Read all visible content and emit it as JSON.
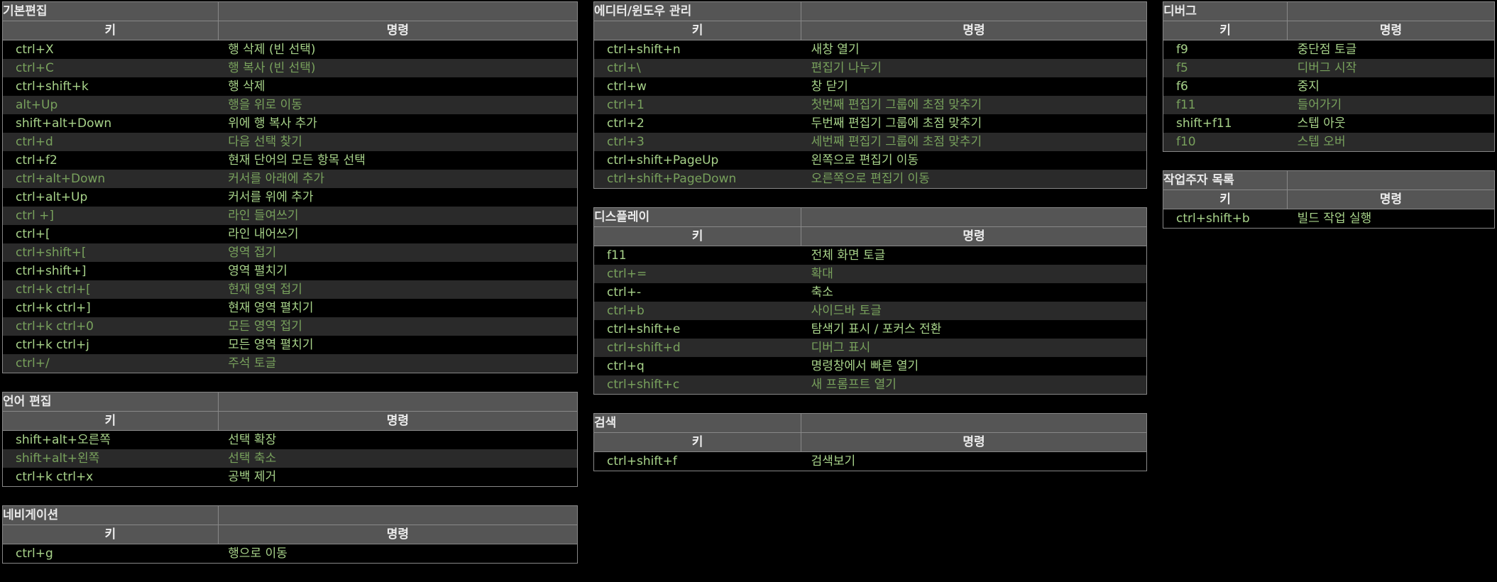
{
  "columns": [
    [
      {
        "title": "기본편집",
        "header_key": "키",
        "header_cmd": "명령",
        "rows": [
          {
            "key": "ctrl+X",
            "cmd": "행 삭제 (빈 선택)"
          },
          {
            "key": "ctrl+C",
            "cmd": "행 복사 (빈 선택)"
          },
          {
            "key": "ctrl+shift+k",
            "cmd": "행 삭제"
          },
          {
            "key": "alt+Up",
            "cmd": "행을 위로 이동"
          },
          {
            "key": "shift+alt+Down",
            "cmd": "위에 행 복사 추가"
          },
          {
            "key": "ctrl+d",
            "cmd": "다음 선택 찾기"
          },
          {
            "key": "ctrl+f2",
            "cmd": "현재 단어의 모든 항목 선택"
          },
          {
            "key": "ctrl+alt+Down",
            "cmd": "커서를 아래에 추가"
          },
          {
            "key": "ctrl+alt+Up",
            "cmd": "커서를 위에 추가"
          },
          {
            "key": "ctrl +]",
            "cmd": "라인 들여쓰기"
          },
          {
            "key": "ctrl+[",
            "cmd": "라인 내어쓰기"
          },
          {
            "key": "ctrl+shift+[",
            "cmd": "영역 접기"
          },
          {
            "key": "ctrl+shift+]",
            "cmd": "영역 펼치기"
          },
          {
            "key": "ctrl+k ctrl+[",
            "cmd": "현재 영역 접기"
          },
          {
            "key": "ctrl+k ctrl+]",
            "cmd": "현재 영역 펼치기"
          },
          {
            "key": "ctrl+k ctrl+0",
            "cmd": "모든 영역 접기"
          },
          {
            "key": "ctrl+k ctrl+j",
            "cmd": "모든 영역 펼치기"
          },
          {
            "key": "ctrl+/",
            "cmd": "주석 토글"
          }
        ]
      },
      {
        "title": "언어 편집",
        "header_key": "키",
        "header_cmd": "명령",
        "rows": [
          {
            "key": "shift+alt+오른쪽",
            "cmd": "선택 확장"
          },
          {
            "key": "shift+alt+왼쪽",
            "cmd": "선택 축소"
          },
          {
            "key": "ctrl+k ctrl+x",
            "cmd": "공백 제거"
          }
        ]
      },
      {
        "title": "네비게이션",
        "header_key": "키",
        "header_cmd": "명령",
        "rows": [
          {
            "key": "ctrl+g",
            "cmd": "행으로 이동"
          }
        ]
      }
    ],
    [
      {
        "title": "에디터/윈도우 관리",
        "header_key": "키",
        "header_cmd": "명령",
        "rows": [
          {
            "key": "ctrl+shift+n",
            "cmd": "새창 열기"
          },
          {
            "key": "ctrl+\\",
            "cmd": "편집기 나누기"
          },
          {
            "key": "ctrl+w",
            "cmd": "창 닫기"
          },
          {
            "key": "ctrl+1",
            "cmd": "첫번째 편집기 그룹에 초점 맞추기"
          },
          {
            "key": "ctrl+2",
            "cmd": "두번째 편집기 그룹에 초점 맞추기"
          },
          {
            "key": "ctrl+3",
            "cmd": "세번째 편집기 그룹에 초점 맞추기"
          },
          {
            "key": "ctrl+shift+PageUp",
            "cmd": "왼쪽으로 편집기 이동"
          },
          {
            "key": "ctrl+shift+PageDown",
            "cmd": "오른쪽으로 편집기 이동"
          }
        ]
      },
      {
        "title": "디스플레이",
        "header_key": "키",
        "header_cmd": "명령",
        "rows": [
          {
            "key": "f11",
            "cmd": "전체 화면 토글"
          },
          {
            "key": "ctrl+=",
            "cmd": "확대"
          },
          {
            "key": "ctrl+-",
            "cmd": "축소"
          },
          {
            "key": "ctrl+b",
            "cmd": "사이드바 토글"
          },
          {
            "key": "ctrl+shift+e",
            "cmd": "탐색기 표시 / 포커스 전환"
          },
          {
            "key": "ctrl+shift+d",
            "cmd": "디버그 표시"
          },
          {
            "key": "ctrl+q",
            "cmd": "명령창에서 빠른 열기"
          },
          {
            "key": "ctrl+shift+c",
            "cmd": "새 프롬프트 열기"
          }
        ]
      },
      {
        "title": "검색",
        "header_key": "키",
        "header_cmd": "명령",
        "rows": [
          {
            "key": "ctrl+shift+f",
            "cmd": "검색보기"
          }
        ]
      }
    ],
    [
      {
        "title": "디버그",
        "header_key": "키",
        "header_cmd": "명령",
        "rows": [
          {
            "key": "f9",
            "cmd": "중단점 토글"
          },
          {
            "key": "f5",
            "cmd": "디버그 시작"
          },
          {
            "key": "f6",
            "cmd": "중지"
          },
          {
            "key": "f11",
            "cmd": "들어가기"
          },
          {
            "key": "shift+f11",
            "cmd": "스텝 아웃"
          },
          {
            "key": "f10",
            "cmd": "스텝 오버"
          }
        ]
      },
      {
        "title": "작업주자 목록",
        "header_key": "키",
        "header_cmd": "명령",
        "rows": [
          {
            "key": "ctrl+shift+b",
            "cmd": "빌드 작업 실행"
          }
        ]
      }
    ]
  ]
}
